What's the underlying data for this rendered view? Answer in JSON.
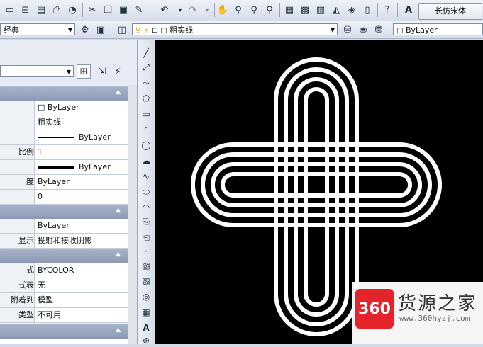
{
  "toolbar_top": {
    "icons": [
      "new-file-icon",
      "open-file-icon",
      "save-icon",
      "print-icon",
      "plot-preview-icon",
      "cut-icon",
      "copy-icon",
      "paste-icon",
      "match-properties-icon",
      "undo-icon",
      "redo-icon",
      "pan-icon",
      "zoom-realtime-icon",
      "zoom-window-icon",
      "zoom-previous-icon",
      "properties-icon",
      "design-center-icon",
      "tool-palettes-icon",
      "sheet-set-icon",
      "markup-icon",
      "calculator-icon",
      "help-icon",
      "text-style-icon"
    ],
    "font_name": "长仿宋体"
  },
  "toolbar_second": {
    "workspace": "经典",
    "layer_name": "粗实线",
    "linetype": "ByLayer"
  },
  "properties_panel": {
    "rows_group1": [
      {
        "label": "",
        "value": "ByLayer"
      },
      {
        "label": "",
        "value": "粗实线"
      },
      {
        "label": "",
        "value": "ByLayer"
      },
      {
        "label": "比例",
        "value": "1"
      },
      {
        "label": "",
        "value": "ByLayer"
      },
      {
        "label": "度",
        "value": "ByLayer"
      },
      {
        "label": "",
        "value": "0"
      }
    ],
    "rows_group2": [
      {
        "label": "",
        "value": "ByLayer"
      },
      {
        "label": "显示",
        "value": "投射和接收阴影"
      }
    ],
    "rows_group3": [
      {
        "label": "式",
        "value": "BYCOLOR"
      },
      {
        "label": "式表",
        "value": "无"
      },
      {
        "label": "附着到",
        "value": "模型"
      },
      {
        "label": "类型",
        "value": "不可用"
      }
    ]
  },
  "watermark": {
    "logo_text": "360",
    "title": "货源之家",
    "url": "www.360hyzj.com"
  }
}
